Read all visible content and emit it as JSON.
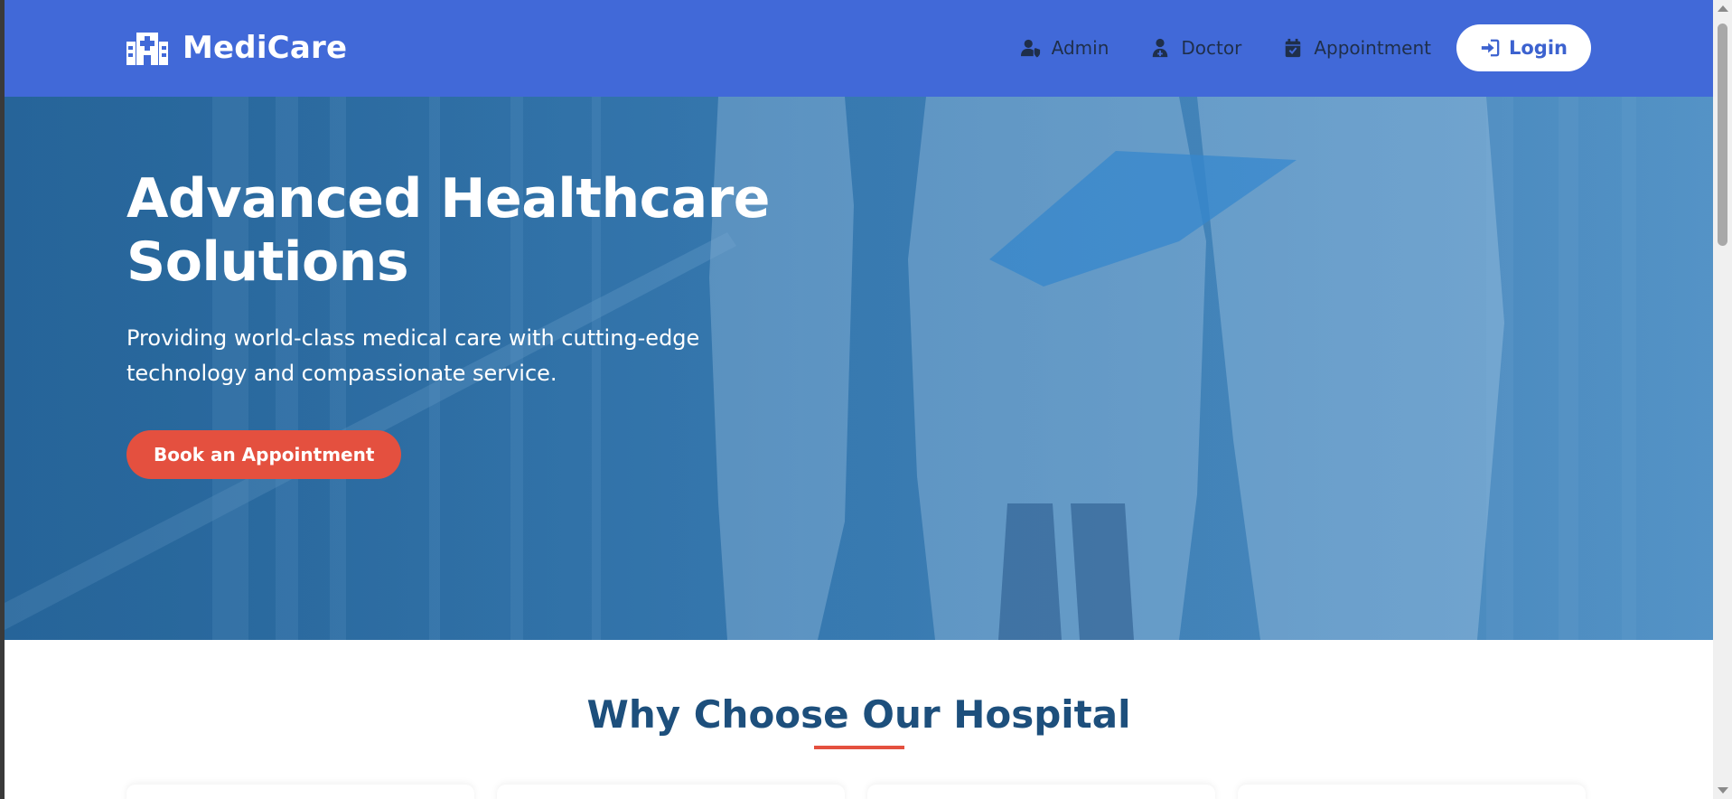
{
  "navbar": {
    "brand": {
      "name": "MediCare",
      "icon": "hospital-icon"
    },
    "links": [
      {
        "label": "Admin",
        "icon": "user-shield-icon"
      },
      {
        "label": "Doctor",
        "icon": "user-doctor-icon"
      },
      {
        "label": "Appointment",
        "icon": "calendar-check-icon"
      }
    ],
    "login": {
      "label": "Login",
      "icon": "sign-in-icon"
    }
  },
  "hero": {
    "title_line1": "Advanced Healthcare",
    "title_line2": "Solutions",
    "subtitle": "Providing world-class medical care with cutting-edge technology and compassionate service.",
    "cta": "Book an Appointment"
  },
  "why": {
    "title": "Why Choose Our Hospital"
  },
  "colors": {
    "navbar": "#4169d8",
    "accent": "#e4503f",
    "heading": "#1d4f7c"
  }
}
